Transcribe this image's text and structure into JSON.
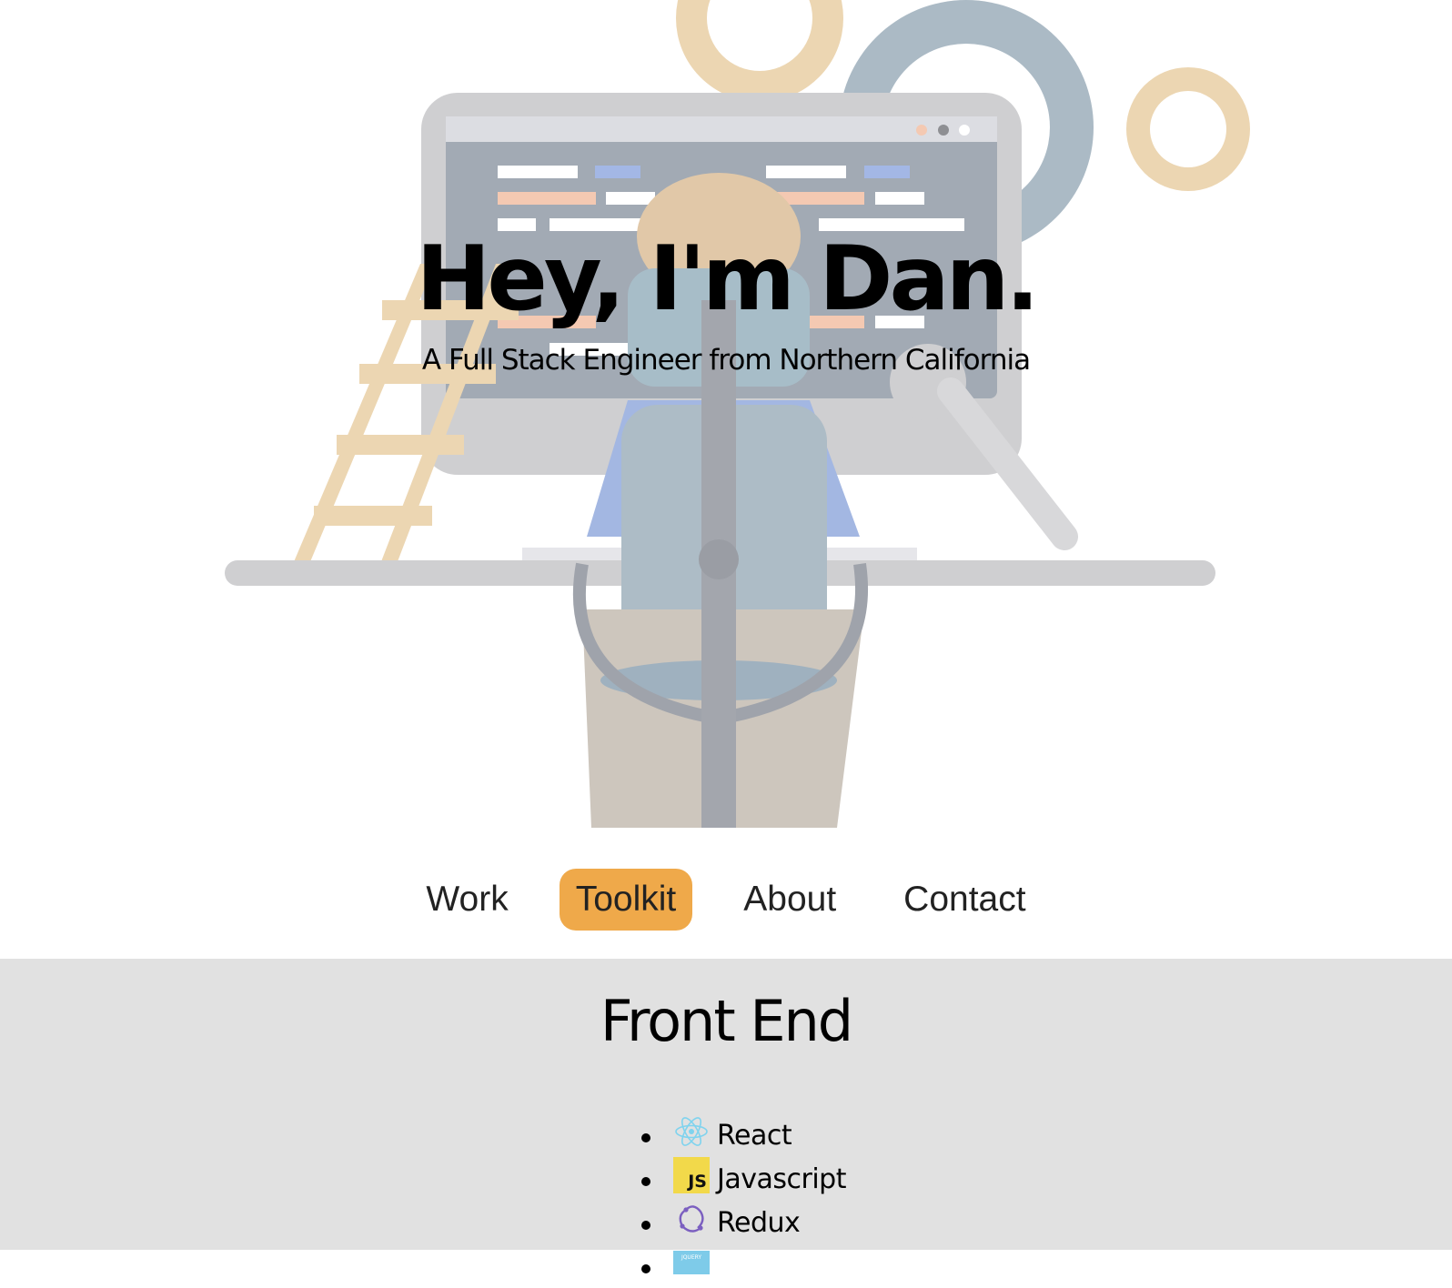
{
  "hero": {
    "title": "Hey, I'm Dan.",
    "subtitle": "A Full Stack Engineer from Northern California"
  },
  "nav": {
    "items": [
      {
        "label": "Work",
        "active": false
      },
      {
        "label": "Toolkit",
        "active": true
      },
      {
        "label": "About",
        "active": false
      },
      {
        "label": "Contact",
        "active": false
      }
    ]
  },
  "toolkit": {
    "section_title": "Front End",
    "items": [
      {
        "label": "React",
        "icon": "react-icon"
      },
      {
        "label": "Javascript",
        "icon": "javascript-icon",
        "badge_text": "JS"
      },
      {
        "label": "Redux",
        "icon": "redux-icon"
      },
      {
        "label": "",
        "icon": "jquery-icon",
        "badge_text": "JQUERY"
      }
    ]
  },
  "colors": {
    "accent": "#efa94a",
    "section_background": "#e1e1e1"
  }
}
